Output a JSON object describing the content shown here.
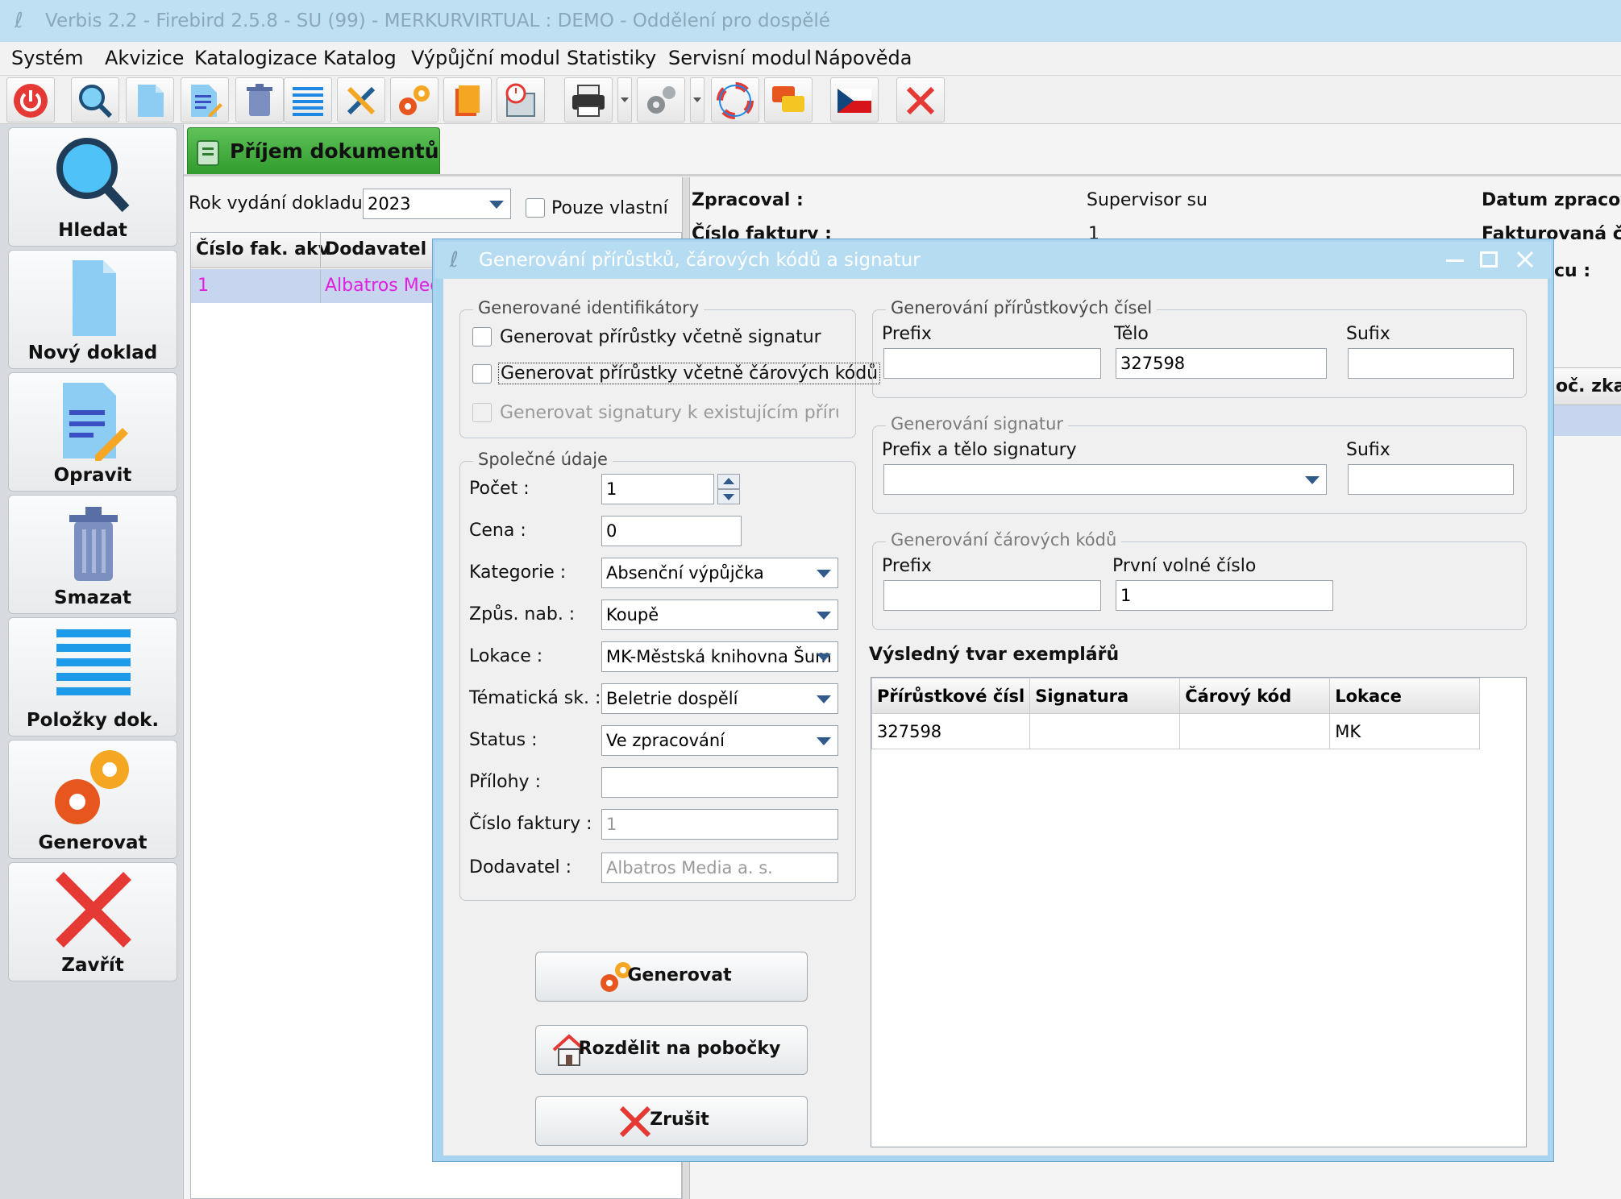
{
  "window": {
    "title": "Verbis 2.2 - Firebird 2.5.8 - SU (99) - MERKURVIRTUAL : DEMO - Oddělení pro dospělé"
  },
  "menu": [
    "Systém",
    "Akvizice",
    "Katalogizace",
    "Katalog",
    "Výpůjční modul",
    "Statistiky",
    "Servisní modul",
    "Nápověda"
  ],
  "left_panel": {
    "search": "Hledat",
    "new_doc": "Nový doklad",
    "edit": "Opravit",
    "delete": "Smazat",
    "items": "Položky dok.",
    "generate": "Generovat",
    "close": "Zavřít"
  },
  "tab": {
    "title": "Příjem dokumentů"
  },
  "filter": {
    "year_label": "Rok vydání dokladu :",
    "year_value": "2023",
    "own_only": "Pouze vlastní"
  },
  "grid": {
    "headers": [
      "Číslo fak. akv",
      "Dodavatel"
    ],
    "row": {
      "num": "1",
      "supplier": "Albatros Media"
    }
  },
  "detail": {
    "processed_label": "Zpracoval :",
    "processed_value": "Supervisor su",
    "date_label": "Datum zpracov",
    "invoice_label": "Číslo faktury :",
    "invoice_value": "1",
    "invoiced_label": "Fakturovaná čá",
    "cu_label": "cu :",
    "count_label": "oč. zkat"
  },
  "dialog": {
    "title": "Generování přírůstků, čárových kódů a signatur",
    "ids_group": "Generované identifikátory",
    "chk_signatures": "Generovat přírůstky včetně signatur",
    "chk_barcodes": "Generovat přírůstky včetně čárových kódů",
    "chk_existing": "Generovat signatury k existujícím přírůstkům",
    "common_group": "Společné údaje",
    "fields": [
      {
        "label": "Počet :",
        "value": "1"
      },
      {
        "label": "Cena :",
        "value": "0"
      },
      {
        "label": "Kategorie :",
        "value": "Absenční výpůjčka"
      },
      {
        "label": "Způs. nab. :",
        "value": "Koupě"
      },
      {
        "label": "Lokace :",
        "value": "MK-Městská knihovna Šum"
      },
      {
        "label": "Tématická sk. :",
        "value": "Beletrie dospělí"
      },
      {
        "label": "Status :",
        "value": "Ve zpracování"
      },
      {
        "label": "Přílohy :",
        "value": ""
      },
      {
        "label": "Číslo faktury :",
        "value": "1"
      },
      {
        "label": "Dodavatel :",
        "value": "Albatros Media a. s."
      }
    ],
    "acc_group": "Generování přírůstkových čísel",
    "acc_prefix_label": "Prefix",
    "acc_body_label": "Tělo",
    "acc_body_value": "327598",
    "acc_suffix_label": "Sufix",
    "sig_group": "Generování signatur",
    "sig_prefix_label": "Prefix a tělo signatury",
    "sig_suffix_label": "Sufix",
    "bar_group": "Generování čárových kódů",
    "bar_prefix_label": "Prefix",
    "bar_first_label": "První volné číslo",
    "bar_first_value": "1",
    "result_title": "Výsledný tvar exemplářů",
    "result_headers": [
      "Přírůstkové čísl",
      "Signatura",
      "Čárový kód",
      "Lokace"
    ],
    "result_row": [
      "327598",
      "",
      "",
      "MK"
    ],
    "btn_generate": "Generovat",
    "btn_split": "Rozdělit na pobočky",
    "btn_cancel": "Zrušit"
  }
}
